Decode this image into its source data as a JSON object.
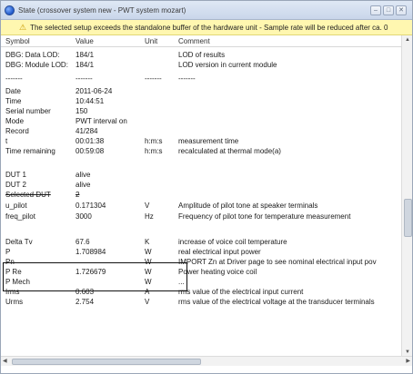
{
  "window": {
    "title": "State (crossover system new - PWT system mozart)"
  },
  "warning": {
    "text": "The selected setup exceeds the standalone buffer of the hardware unit - Sample rate will be reduced after ca. 0"
  },
  "table": {
    "headers": {
      "symbol": "Symbol",
      "value": "Value",
      "unit": "Unit",
      "comment": "Comment"
    },
    "rows": [
      {
        "symbol": "DBG: Data LOD:",
        "value": "184/1",
        "unit": "",
        "comment": "LOD of results"
      },
      {
        "symbol": "DBG: Module LOD:",
        "value": "184/1",
        "unit": "",
        "comment": "LOD version in current module"
      },
      {
        "symbol": "-------",
        "value": "-------",
        "unit": "-------",
        "comment": "-------"
      },
      {
        "symbol": "Date",
        "value": "2011-06-24",
        "unit": "",
        "comment": ""
      },
      {
        "symbol": "Time",
        "value": "10:44:51",
        "unit": "",
        "comment": ""
      },
      {
        "symbol": "Serial number",
        "value": "150",
        "unit": "",
        "comment": ""
      },
      {
        "symbol": "Mode",
        "value": "PWT interval on",
        "unit": "",
        "comment": ""
      },
      {
        "symbol": "Record",
        "value": "41/284",
        "unit": "",
        "comment": ""
      },
      {
        "symbol": "t",
        "value": "00:01:38",
        "unit": "h:m:s",
        "comment": "measurement time"
      },
      {
        "symbol": "Time remaining",
        "value": "00:59:08",
        "unit": "h:m:s",
        "comment": "recalculated at thermal mode(a)"
      },
      {
        "symbol": "",
        "value": "",
        "unit": "",
        "comment": ""
      },
      {
        "symbol": "DUT 1",
        "value": "alive",
        "unit": "",
        "comment": ""
      },
      {
        "symbol": "DUT 2",
        "value": "alive",
        "unit": "",
        "comment": ""
      },
      {
        "symbol": "Selected DUT",
        "value": "2",
        "unit": "",
        "comment": ""
      },
      {
        "symbol": "u_pilot",
        "value": "0.171304",
        "unit": "V",
        "comment": "Amplitude of pilot tone at speaker terminals"
      },
      {
        "symbol": "freq_pilot",
        "value": "3000",
        "unit": "Hz",
        "comment": "Frequency of pilot tone for temperature measurement"
      },
      {
        "symbol": "",
        "value": "",
        "unit": "",
        "comment": ""
      },
      {
        "symbol": "Delta Tv",
        "value": "67.6",
        "unit": "K",
        "comment": "increase of voice coil temperature"
      },
      {
        "symbol": "P",
        "value": "1.708984",
        "unit": "W",
        "comment": "real electrical input power"
      },
      {
        "symbol": "Pn",
        "value": "",
        "unit": "W",
        "comment": "IMPORT Zn at Driver page to see nominal electrical input pov"
      },
      {
        "symbol": "P Re",
        "value": "1.726679",
        "unit": "W",
        "comment": "Power heating voice coil"
      },
      {
        "symbol": "P Mech",
        "value": "",
        "unit": "W",
        "comment": "..."
      },
      {
        "symbol": "Irms",
        "value": "0.603",
        "unit": "A",
        "comment": "rms value of the electrical input current"
      },
      {
        "symbol": "Urms",
        "value": "2.754",
        "unit": "V",
        "comment": "rms value of the electrical voltage at the transducer terminals"
      }
    ]
  }
}
